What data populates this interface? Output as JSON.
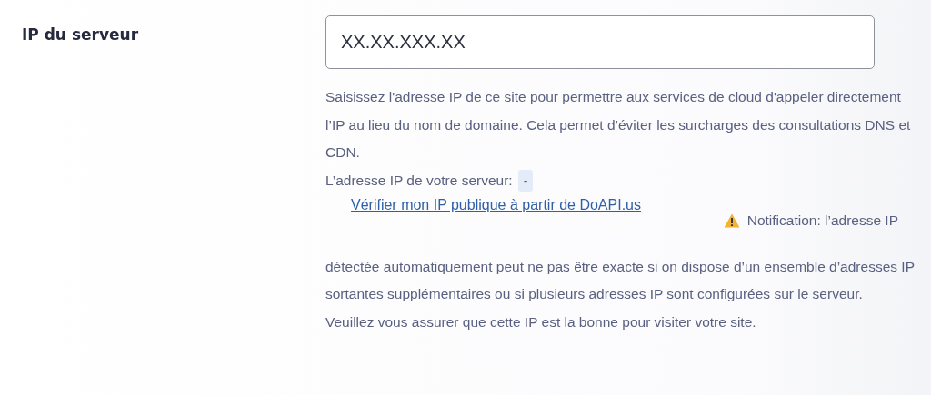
{
  "field": {
    "label": "IP du serveur",
    "value": "XX.XX.XXX.XX"
  },
  "description": "Saisissez l'adresse IP de ce site pour permettre aux services de cloud d'appeler directement l’IP au lieu du nom de domaine. Cela permet d’éviter les surcharges des consultations DNS et CDN.",
  "current_ip": {
    "label": "L’adresse IP de votre serveur:",
    "value": "-"
  },
  "link": "Vérifier mon IP publique à partir de DoAPI.us",
  "notification": {
    "lead": "Notification: l’adresse IP",
    "rest": "détectée automatiquement peut ne pas être exacte si on dispose d’un ensemble d’adresses IP sortantes supplémentaires ou si plusieurs adresses IP sont configurées sur le serveur."
  },
  "note": "Veuillez vous assurer que cette IP est la bonne pour visiter votre site."
}
